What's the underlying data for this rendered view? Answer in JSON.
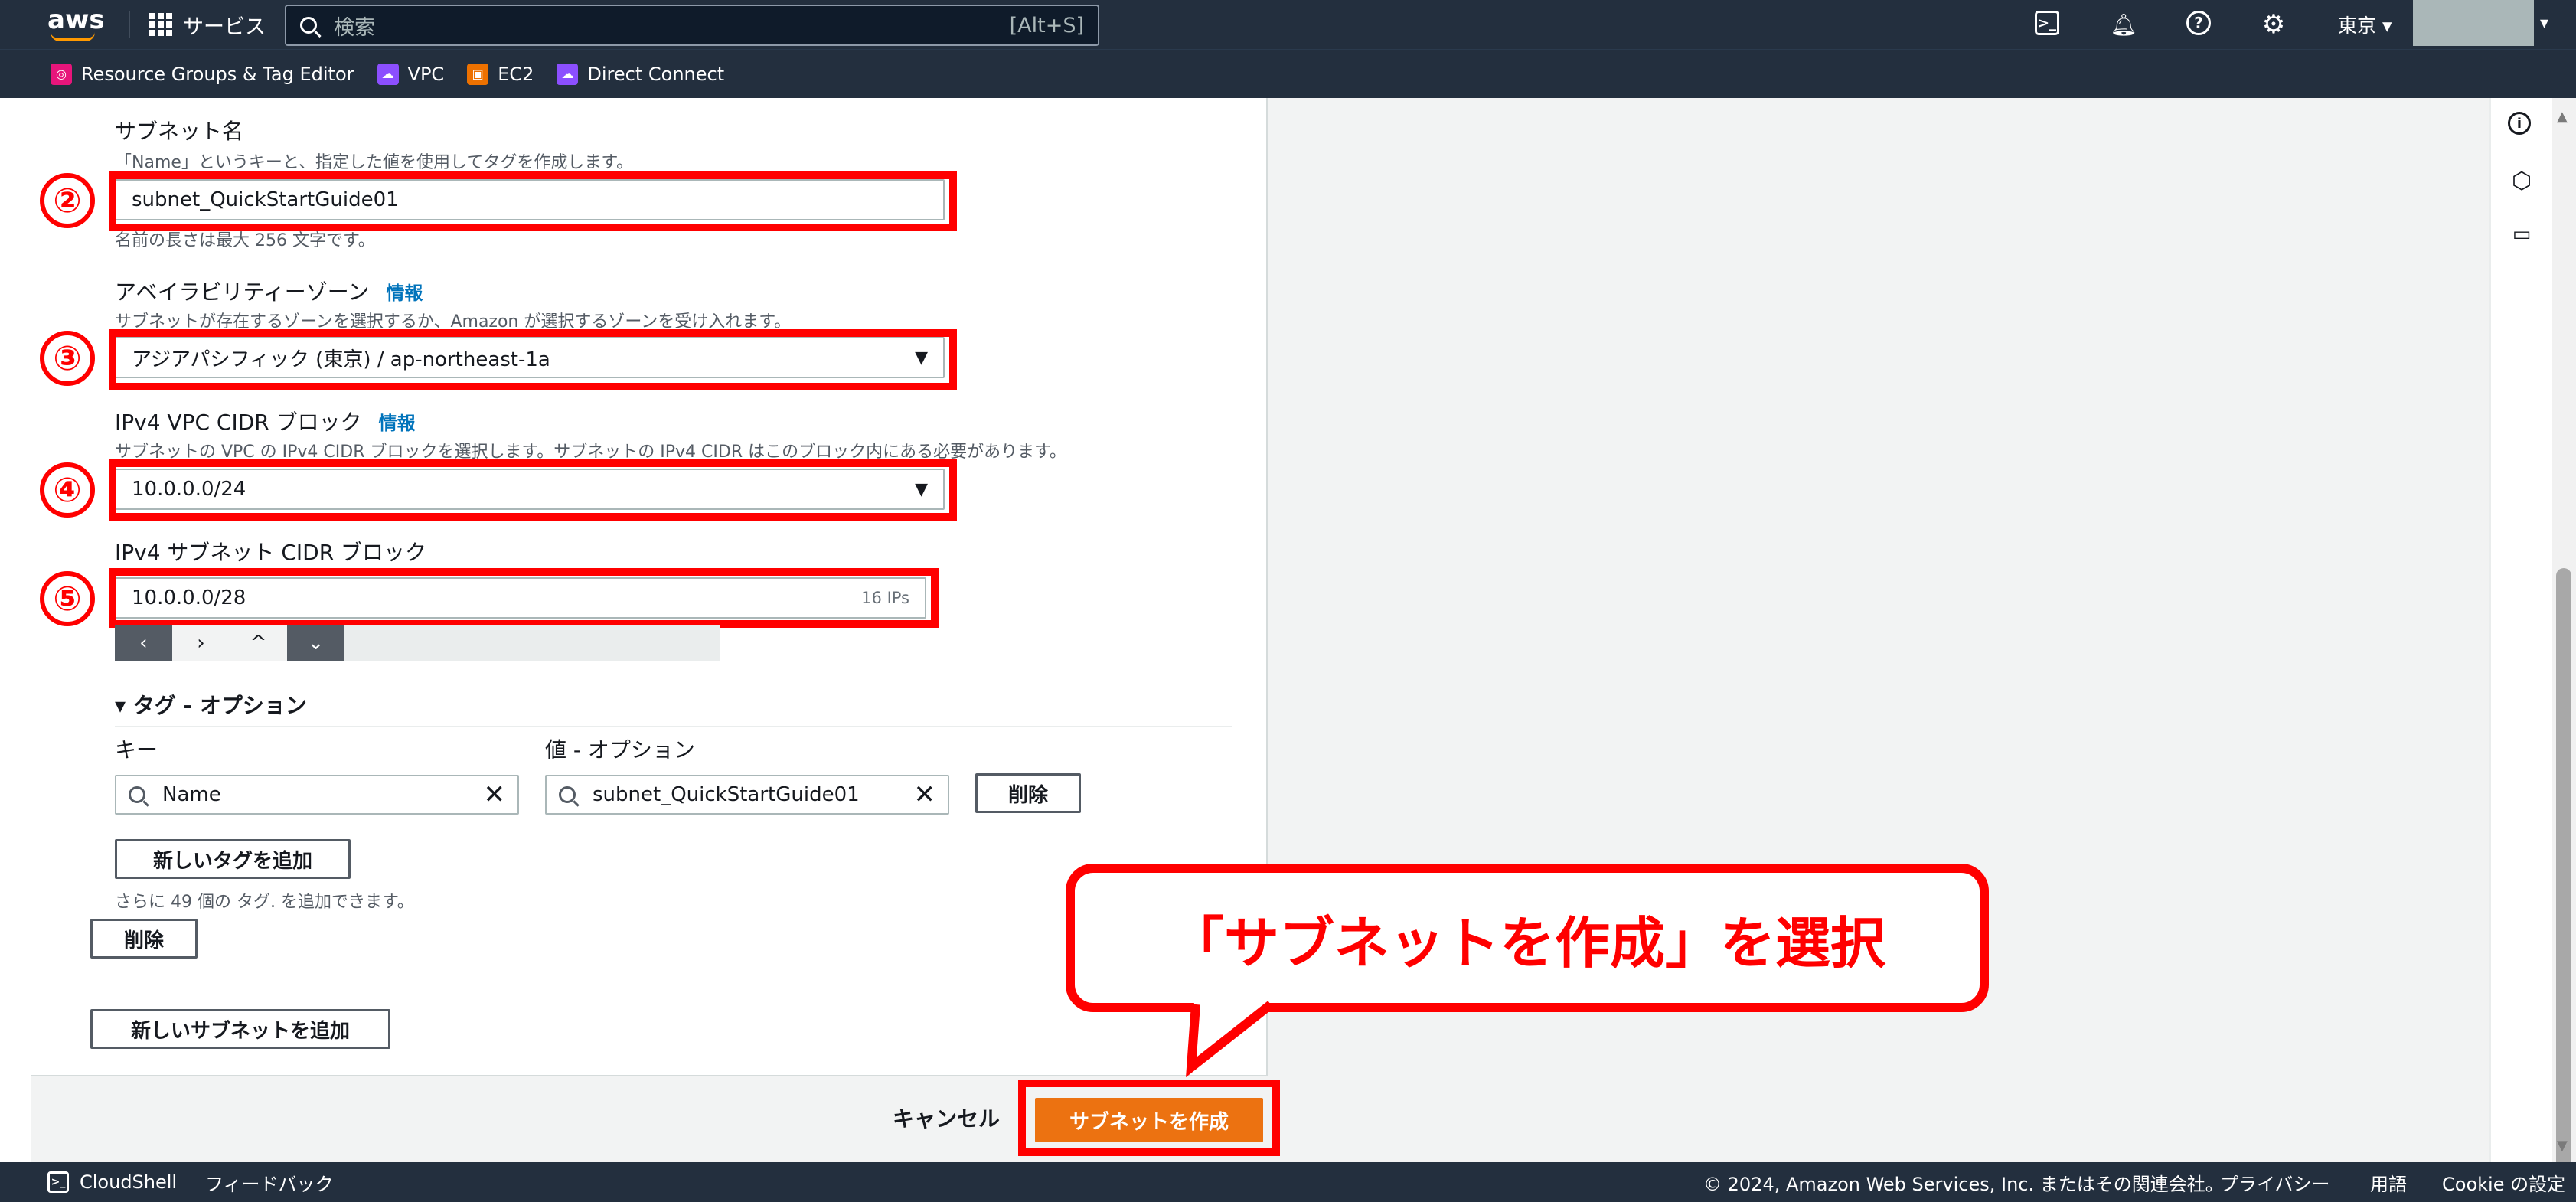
{
  "topbar": {
    "services_label": "サービス",
    "search_placeholder": "検索",
    "search_shortcut": "[Alt+S]",
    "region": "東京 ▾"
  },
  "favorites": [
    {
      "label": "Resource Groups & Tag Editor",
      "color": "#e7157b"
    },
    {
      "label": "VPC",
      "color": "#8c4fff"
    },
    {
      "label": "EC2",
      "color": "#ed7100"
    },
    {
      "label": "Direct Connect",
      "color": "#8c4fff"
    }
  ],
  "form": {
    "subnet_name_label": "サブネット名",
    "subnet_name_desc": "「Name」というキーと、指定した値を使用してタグを作成します。",
    "subnet_name_value": "subnet_QuickStartGuide01",
    "subnet_name_hint": "名前の長さは最大 256 文字です。",
    "az_label": "アベイラビリティーゾーン",
    "az_info": "情報",
    "az_desc": "サブネットが存在するゾーンを選択するか、Amazon が選択するゾーンを受け入れます。",
    "az_value": "アジアパシフィック (東京) / ap-northeast-1a",
    "vpc_cidr_label": "IPv4 VPC CIDR ブロック",
    "vpc_cidr_info": "情報",
    "vpc_cidr_desc": "サブネットの VPC の IPv4 CIDR ブロックを選択します。サブネットの IPv4 CIDR はこのブロック内にある必要があります。",
    "vpc_cidr_value": "10.0.0.0/24",
    "subnet_cidr_label": "IPv4 サブネット CIDR ブロック",
    "subnet_cidr_value": "10.0.0.0/28",
    "subnet_cidr_ips": "16 IPs",
    "stepper": [
      "‹",
      "›",
      "^",
      "⌄"
    ],
    "tags_heading": "▾ タグ - オプション",
    "tag_key_label": "キー",
    "tag_value_label": "値 - オプション",
    "tag_key_value": "Name",
    "tag_value_value": "subnet_QuickStartGuide01",
    "tag_remove": "削除",
    "add_tag": "新しいタグを追加",
    "tags_remaining": "さらに 49 個の タグ. を追加できます。",
    "remove_subnet": "削除",
    "add_subnet": "新しいサブネットを追加"
  },
  "annotations": {
    "num2": "②",
    "num3": "③",
    "num4": "④",
    "num5": "⑤",
    "callout": "「サブネットを作成」を選択"
  },
  "actions": {
    "cancel": "キャンセル",
    "create": "サブネットを作成"
  },
  "footer": {
    "cloudshell": "CloudShell",
    "feedback": "フィードバック",
    "copyright": "© 2024, Amazon Web Services, Inc. またはその関連会社。",
    "privacy": "プライバシー",
    "terms": "用語",
    "cookie": "Cookie の設定"
  }
}
